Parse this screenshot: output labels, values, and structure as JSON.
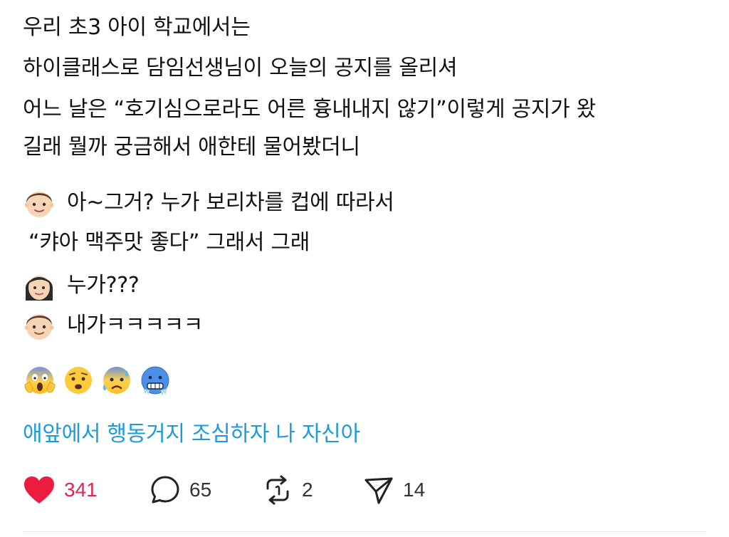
{
  "post": {
    "lines": [
      "우리 초3 아이 학교에서는",
      "하이클래스로 담임선생님이 오늘의 공지를 올리셔",
      "어느 날은 “호기심으로라도 어른 흉내내지 않기”이렇게 공지가 왔",
      "길래 뭘까 궁금해서 애한테 물어봤더니"
    ],
    "dialogue": [
      {
        "speaker_icon": "boy-face-icon",
        "text": "아~그거? 누가 보리차를 컵에 따라서"
      },
      {
        "speaker_icon": "",
        "text": "“캬아 맥주맛 좋다” 그래서 그래"
      },
      {
        "speaker_icon": "woman-face-icon",
        "text": "누가???"
      },
      {
        "speaker_icon": "boy-face-icon",
        "text": "내가ㅋㅋㅋㅋㅋ"
      }
    ],
    "reaction_emojis": [
      "screaming-face-icon",
      "anxious-face-icon",
      "anxious-sweat-face-icon",
      "cold-face-icon"
    ],
    "closing_line": "애앞에서 행동거지 조심하자 나 자신아",
    "closing_color": "#1d9bd8"
  },
  "actions": {
    "like": {
      "icon": "heart-icon",
      "count": "341",
      "color": "#e0244a"
    },
    "reply": {
      "icon": "comment-bubble-icon",
      "count": "65"
    },
    "repost": {
      "icon": "repost-icon",
      "count": "2"
    },
    "share": {
      "icon": "send-icon",
      "count": "14"
    }
  }
}
